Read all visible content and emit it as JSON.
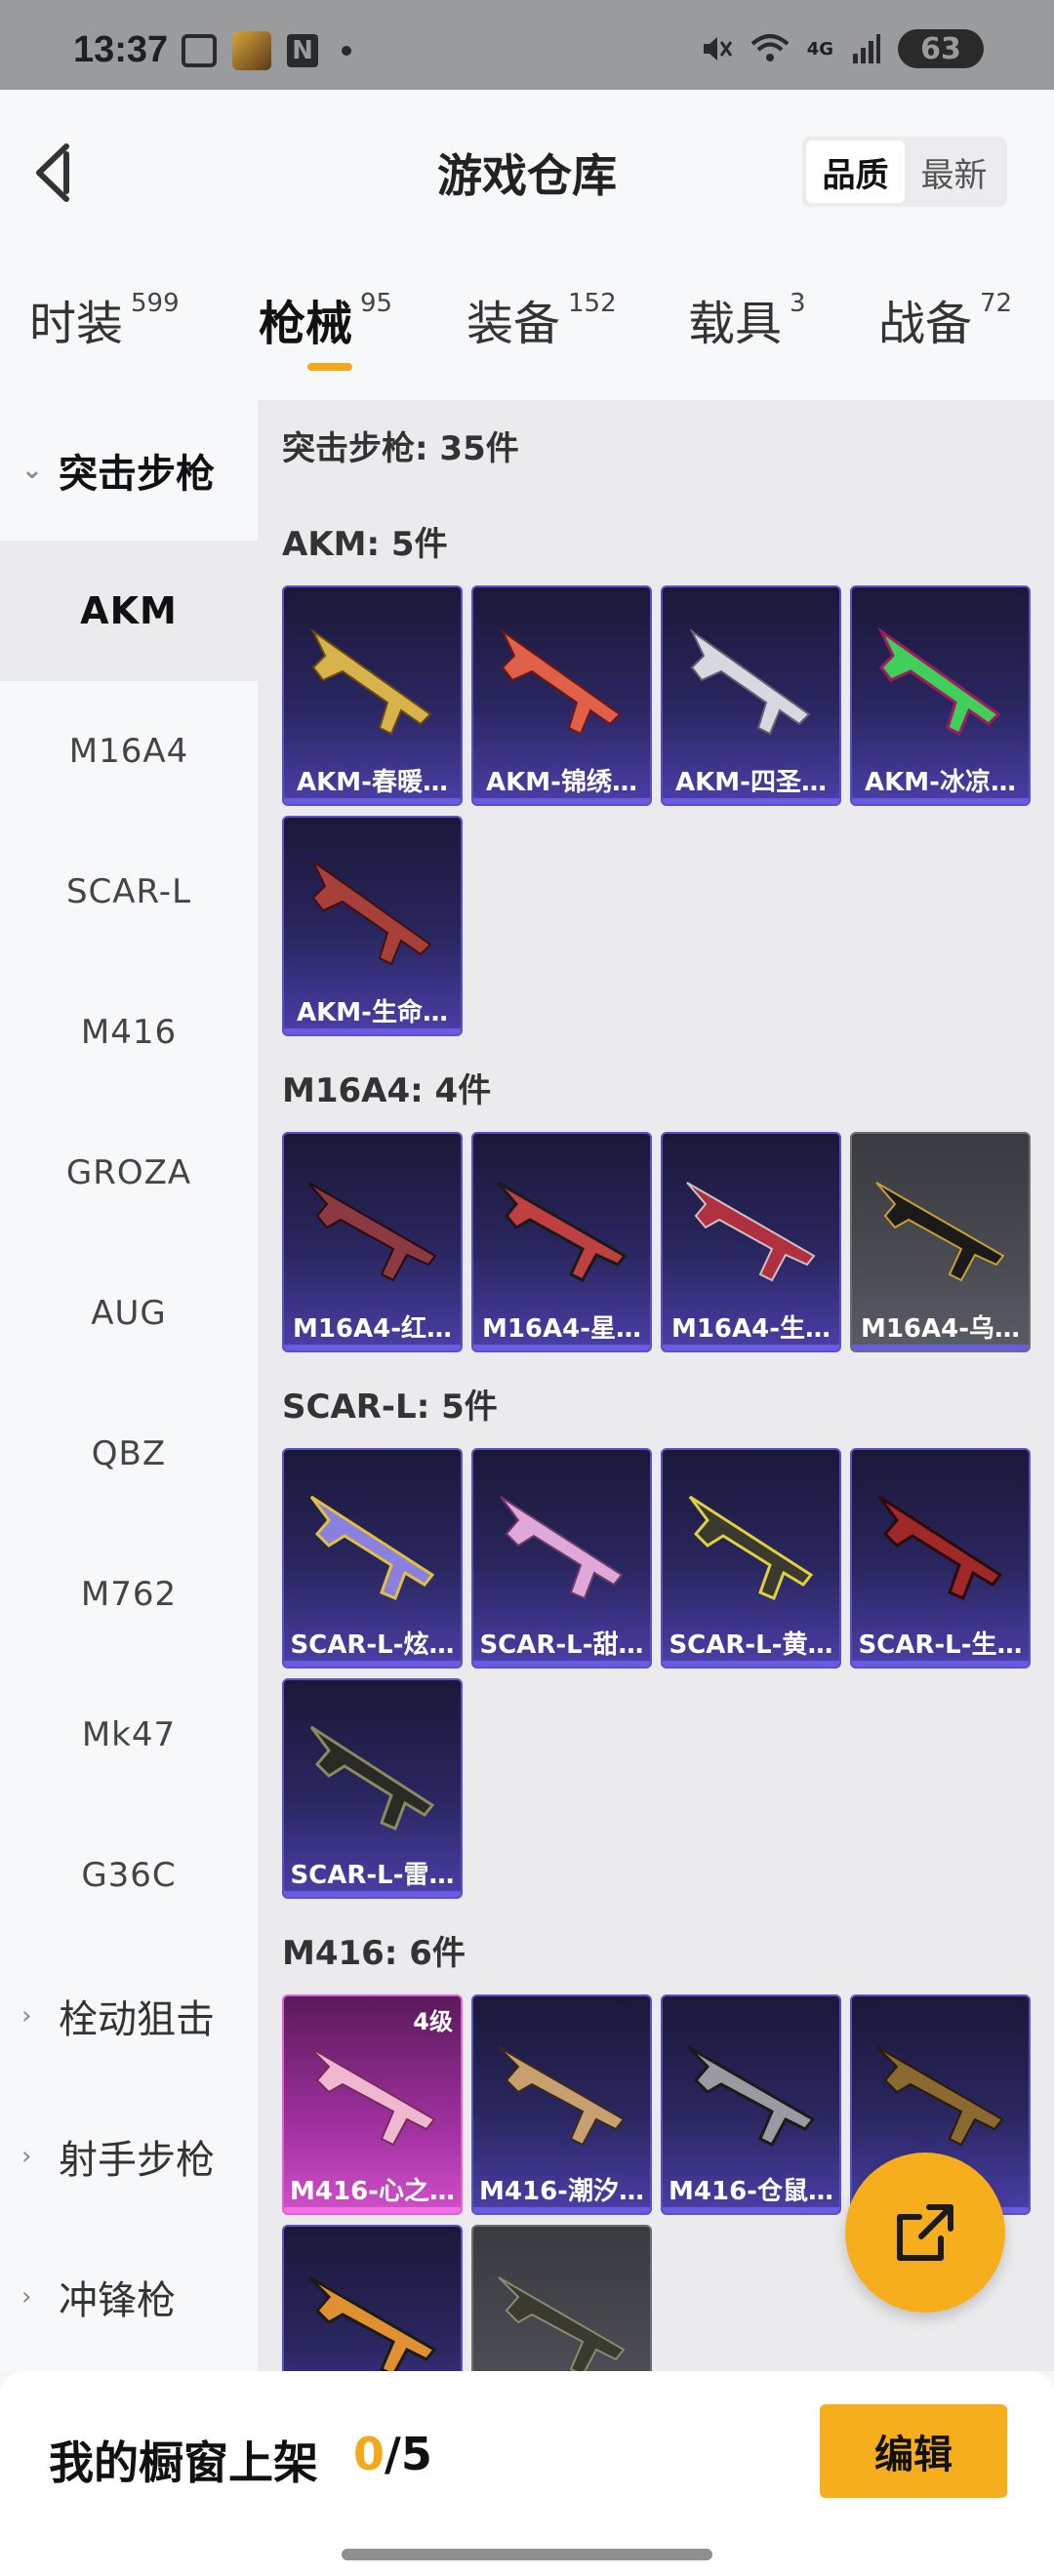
{
  "status_bar": {
    "time": "13:37",
    "network": "4G",
    "battery": "63",
    "icons": [
      "screenshot-icon",
      "game-app-icon",
      "nfc-icon",
      "dot-icon",
      "mute-icon",
      "wifi-icon",
      "signal-icon",
      "battery-icon"
    ]
  },
  "header": {
    "title": "游戏仓库",
    "sort": {
      "quality": "品质",
      "newest": "最新",
      "selected": "品质"
    }
  },
  "tabs": [
    {
      "label": "时装",
      "count": "599"
    },
    {
      "label": "枪械",
      "count": "95",
      "active": true
    },
    {
      "label": "装备",
      "count": "152"
    },
    {
      "label": "载具",
      "count": "3"
    },
    {
      "label": "战备",
      "count": "72"
    }
  ],
  "sidebar": {
    "group_open": "突击步枪",
    "items": [
      "AKM",
      "M16A4",
      "SCAR-L",
      "M416",
      "GROZA",
      "AUG",
      "QBZ",
      "M762",
      "Mk47",
      "G36C"
    ],
    "active_item": "AKM",
    "groups_collapsed": [
      "栓动狙击",
      "射手步枪",
      "冲锋枪"
    ]
  },
  "content": {
    "title": "突击步枪: 35件",
    "sections": [
      {
        "title": "AKM: 5件",
        "cards": [
          {
            "name": "AKM-春暖…",
            "variant": "purple"
          },
          {
            "name": "AKM-锦绣…",
            "variant": "purple"
          },
          {
            "name": "AKM-四圣…",
            "variant": "purple"
          },
          {
            "name": "AKM-冰凉…",
            "variant": "purple"
          },
          {
            "name": "AKM-生命…",
            "variant": "purple"
          }
        ]
      },
      {
        "title": "M16A4: 4件",
        "cards": [
          {
            "name": "M16A4-红…",
            "variant": "purple"
          },
          {
            "name": "M16A4-星…",
            "variant": "purple"
          },
          {
            "name": "M16A4-生…",
            "variant": "purple"
          },
          {
            "name": "M16A4-乌…",
            "variant": "gray"
          }
        ]
      },
      {
        "title": "SCAR-L: 5件",
        "cards": [
          {
            "name": "SCAR-L-炫…",
            "variant": "purple"
          },
          {
            "name": "SCAR-L-甜…",
            "variant": "purple"
          },
          {
            "name": "SCAR-L-黄…",
            "variant": "purple"
          },
          {
            "name": "SCAR-L-生…",
            "variant": "purple"
          },
          {
            "name": "SCAR-L-雷…",
            "variant": "purple"
          }
        ]
      },
      {
        "title": "M416: 6件",
        "cards": [
          {
            "name": "M416-心之…",
            "variant": "pink",
            "level": "4级"
          },
          {
            "name": "M416-潮汐…",
            "variant": "purple"
          },
          {
            "name": "M416-仓鼠…",
            "variant": "purple"
          },
          {
            "name": "…",
            "variant": "purple"
          },
          {
            "name": "",
            "variant": "purple"
          },
          {
            "name": "",
            "variant": "gray"
          }
        ]
      }
    ]
  },
  "bottom": {
    "label": "我的橱窗上架",
    "current": "0",
    "total": "/5",
    "edit": "编辑"
  },
  "colors": {
    "accent": "#f7ae1d",
    "card_purple": "#4a3fa8",
    "card_pink": "#d050c8"
  }
}
